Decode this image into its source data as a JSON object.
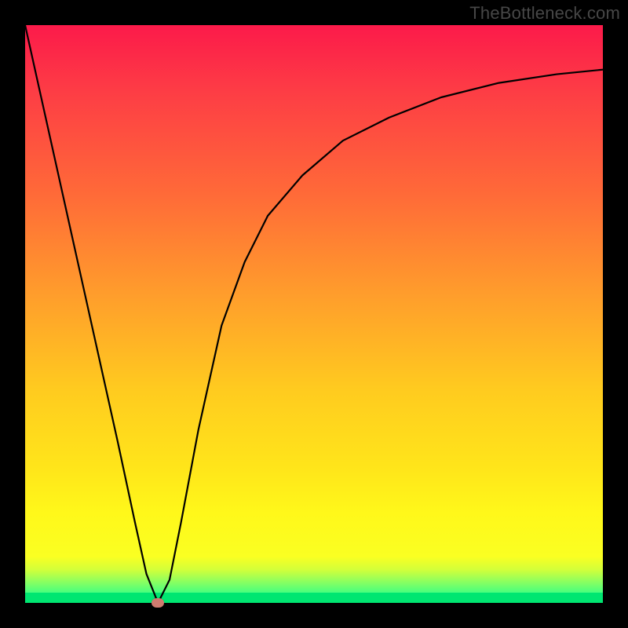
{
  "watermark": "TheBottleneck.com",
  "chart_data": {
    "type": "line",
    "title": "",
    "xlabel": "",
    "ylabel": "",
    "xlim": [
      0,
      100
    ],
    "ylim": [
      0,
      100
    ],
    "grid": false,
    "legend": false,
    "background_gradient": {
      "stops": [
        {
          "pos": 0.0,
          "color": "#fc1a4a"
        },
        {
          "pos": 0.3,
          "color": "#ff6a38"
        },
        {
          "pos": 0.6,
          "color": "#ffcb1f"
        },
        {
          "pos": 0.82,
          "color": "#fff81a"
        },
        {
          "pos": 0.95,
          "color": "#8fff5e"
        },
        {
          "pos": 1.0,
          "color": "#00e671"
        }
      ]
    },
    "series": [
      {
        "name": "bottleneck-curve",
        "color": "#000000",
        "x": [
          0,
          4,
          8,
          12,
          16,
          19,
          21,
          23,
          25,
          27,
          30,
          34,
          38,
          42,
          48,
          55,
          63,
          72,
          82,
          92,
          100
        ],
        "y": [
          100,
          82,
          64,
          46,
          28,
          14,
          5,
          0,
          4,
          14,
          30,
          48,
          59,
          67,
          74,
          80,
          84,
          87.5,
          90,
          91.5,
          92.3
        ]
      }
    ],
    "marker": {
      "name": "optimal-point",
      "x": 23,
      "y": 0,
      "color": "#cf7b6f"
    }
  }
}
